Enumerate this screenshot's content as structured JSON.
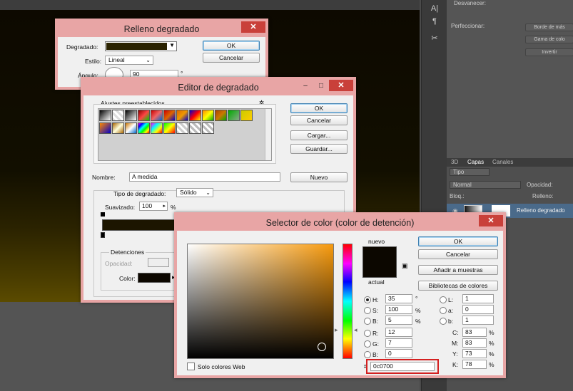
{
  "right_panel": {
    "desvanecer": "Desvanecer:",
    "perfeccionar": "Perfeccionar:",
    "btn_borde": "Borde de más",
    "btn_gama": "Gama de colo",
    "btn_invertir": "Invertir",
    "tabs": [
      "3D",
      "Capas",
      "Canales"
    ],
    "filter_kind": "Tipo",
    "blend_mode": "Normal",
    "opacity_label": "Opacidad:",
    "lock_label": "Bloq.:",
    "fill_label": "Relleno:",
    "layer_name": "Relleno degradado"
  },
  "relleno": {
    "title": "Relleno degradado",
    "close": "✕",
    "degradado_label": "Degradado:",
    "estilo_label": "Estilo:",
    "estilo_value": "Lineal",
    "angulo_label": "Ángulo:",
    "angulo_value": "90",
    "deg_symbol": "°",
    "ok": "OK",
    "cancel": "Cancelar"
  },
  "editor": {
    "title": "Editor de degradado",
    "min": "–",
    "max": "□",
    "close": "✕",
    "presets_label": "Ajustes preestablecidos",
    "gear": "✲",
    "ok": "OK",
    "cancel": "Cancelar",
    "load": "Cargar...",
    "save": "Guardar...",
    "nombre_label": "Nombre:",
    "nombre_value": "A medida",
    "nuevo": "Nuevo",
    "tipo_label": "Tipo de degradado:",
    "tipo_value": "Sólido",
    "suavizado_label": "Suavizado:",
    "suavizado_value": "100",
    "pct": "%",
    "detenciones_label": "Detenciones",
    "opacidad_label": "Opacidad:",
    "color_label": "Color:",
    "preset_colors": [
      "#000",
      "#ccc",
      "#444",
      "#c00",
      "#e66",
      "#c00",
      "#d60",
      "#e90",
      "#0a0",
      "#f80",
      "#a40",
      "#cc0",
      "#c70",
      "#f0f",
      "#8a8",
      "#ccc",
      "#ccc"
    ]
  },
  "picker": {
    "title": "Selector de color (color de detención)",
    "close": "✕",
    "nuevo": "nuevo",
    "actual": "actual",
    "ok": "OK",
    "cancel": "Cancelar",
    "add_swatch": "Añadir a muestras",
    "libraries": "Bibliotecas de colores",
    "web_only": "Solo colores Web",
    "hsb": [
      {
        "label": "H:",
        "value": "35",
        "unit": "°"
      },
      {
        "label": "S:",
        "value": "100",
        "unit": "%"
      },
      {
        "label": "B:",
        "value": "5",
        "unit": "%"
      }
    ],
    "rgb": [
      {
        "label": "R:",
        "value": "12"
      },
      {
        "label": "G:",
        "value": "7"
      },
      {
        "label": "B:",
        "value": "0"
      }
    ],
    "lab": [
      {
        "label": "L:",
        "value": "1"
      },
      {
        "label": "a:",
        "value": "0"
      },
      {
        "label": "b:",
        "value": "1"
      }
    ],
    "cmyk": [
      {
        "label": "C:",
        "value": "83",
        "unit": "%"
      },
      {
        "label": "M:",
        "value": "83",
        "unit": "%"
      },
      {
        "label": "Y:",
        "value": "73",
        "unit": "%"
      },
      {
        "label": "K:",
        "value": "78",
        "unit": "%"
      }
    ],
    "hex_prefix": "#",
    "hex": "0c0700",
    "highlight_color": "#d42020"
  }
}
